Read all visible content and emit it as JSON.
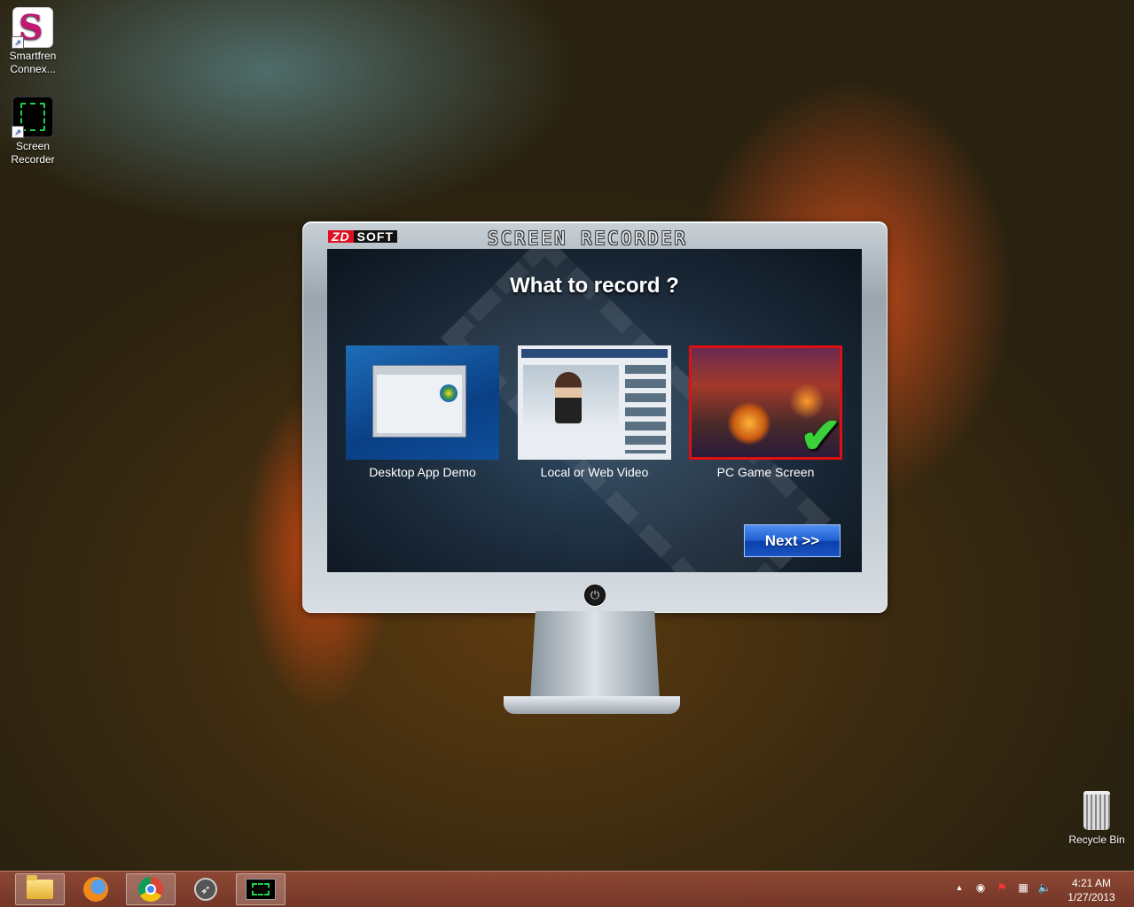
{
  "desktop": {
    "icons": [
      {
        "label": "Smartfren Connex...",
        "icon": "smartfren-icon"
      },
      {
        "label": "Screen Recorder",
        "icon": "screen-recorder-icon"
      }
    ],
    "recycle_bin": "Recycle Bin"
  },
  "app": {
    "logo_zd": "ZD",
    "logo_soft": "SOFT",
    "title": "SCREEN RECORDER",
    "heading": "What to record ?",
    "options": [
      {
        "label": "Desktop App Demo",
        "selected": false
      },
      {
        "label": "Local or Web Video",
        "selected": false
      },
      {
        "label": "PC Game Screen",
        "selected": true
      }
    ],
    "check_mark": "✔",
    "next_button": "Next >>",
    "power_icon": "power-icon",
    "accent_color": "#e01010",
    "button_color": "#1f5fd0"
  },
  "taskbar": {
    "apps": [
      {
        "name": "File Explorer",
        "icon": "folder-icon",
        "active": true
      },
      {
        "name": "Firefox",
        "icon": "firefox-icon",
        "active": false
      },
      {
        "name": "Chrome",
        "icon": "chrome-icon",
        "active": true
      },
      {
        "name": "Rocket",
        "icon": "rocket-icon",
        "active": false
      },
      {
        "name": "Screen Recorder",
        "icon": "screen-recorder-icon",
        "active": true
      }
    ],
    "tray": {
      "chevron": "▲",
      "time": "4:21 AM",
      "date": "1/27/2013"
    }
  }
}
